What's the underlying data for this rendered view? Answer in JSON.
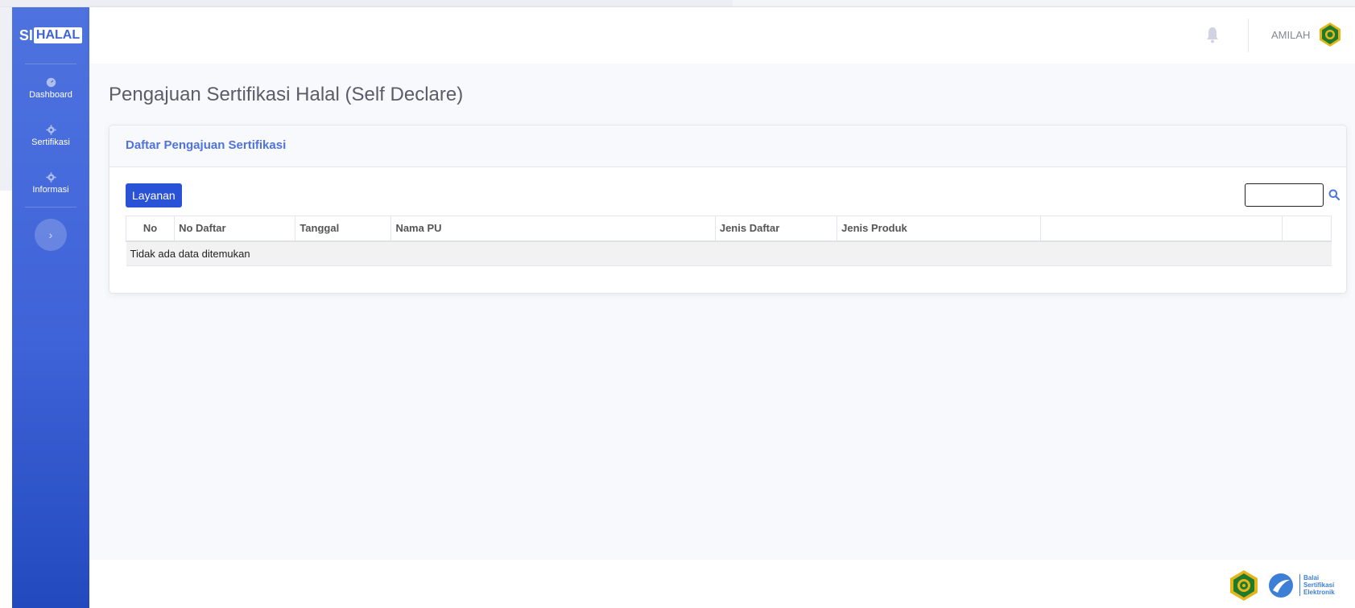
{
  "brand": {
    "si": "SI",
    "halal": "HALAL"
  },
  "sidebar": {
    "items": [
      {
        "label": "Dashboard",
        "icon": "dashboard-icon"
      },
      {
        "label": "Sertifikasi",
        "icon": "gear-icon"
      },
      {
        "label": "Informasi",
        "icon": "gear-icon"
      }
    ],
    "toggle_symbol": "›"
  },
  "topbar": {
    "username": "AMILAH",
    "bell_icon": "bell-icon"
  },
  "page": {
    "title": "Pengajuan Sertifikasi Halal (Self Declare)"
  },
  "card": {
    "title": "Daftar Pengajuan Sertifikasi",
    "button_label": "Layanan",
    "search_value": "",
    "columns": [
      "No",
      "No Daftar",
      "Tanggal",
      "Nama PU",
      "Jenis Daftar",
      "Jenis Produk",
      "",
      ""
    ],
    "empty_message": "Tidak ada data ditemukan"
  },
  "footer": {
    "bse_text": [
      "Balai",
      "Sertifikasi",
      "Elektronik"
    ]
  },
  "colors": {
    "primary": "#4e73df",
    "button": "#2a52d6",
    "kemenag_green": "#1f7a2e",
    "kemenag_gold": "#e4b61a"
  }
}
